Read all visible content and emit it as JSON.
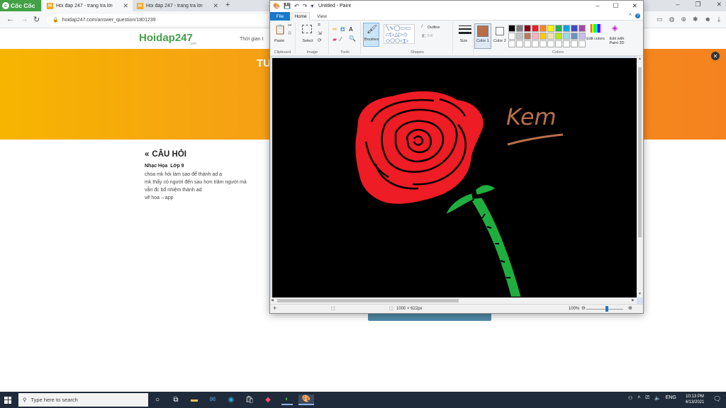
{
  "browser": {
    "brand": "Cốc Cốc",
    "tabs": [
      {
        "label": "Hỏi đáp 247 - trang tra lời"
      },
      {
        "label": "Hỏi đáp 247 - trang tra lời"
      }
    ],
    "url": "hoidap247.com/answer_question/1801239"
  },
  "site": {
    "logo": "Hoidap247",
    "logo_domain": ".com",
    "nav_text": "Thời gian t",
    "banner_title": "TU",
    "question": {
      "heading": "CÂU HỎI",
      "subject": "Nhạc Họa",
      "grade": "Lớp 9",
      "lines": [
        "choa mk hỏi làm sao để thành ad ạ",
        "mk thấy có người đến sau hơn trăm người mà",
        "vẫn đc bổ nhiệm thành ad",
        "vẽ hoa – app"
      ]
    }
  },
  "paint": {
    "title": "Untitled - Paint",
    "menus": {
      "file": "File",
      "home": "Home",
      "view": "View"
    },
    "groups": {
      "clipboard": "Clipboard",
      "image": "Image",
      "tools": "Tools",
      "shapes": "Shapes",
      "colors": "Colors"
    },
    "buttons": {
      "paste": "Paste",
      "select": "Select",
      "brushes": "Brushes",
      "outline": "Outline",
      "fill": "Fill",
      "size": "Size",
      "color1": "Color 1",
      "color2": "Color 2",
      "edit_colors": "Edit colors",
      "edit_with_paint3d": "Edit with Paint 3D"
    },
    "color1": "#b86f48",
    "color2": "#ffffff",
    "palette": [
      "#000000",
      "#7f7f7f",
      "#880015",
      "#ed1c24",
      "#ff7f27",
      "#fff200",
      "#22b14c",
      "#00a2e8",
      "#3f48cc",
      "#a349a4",
      "#ffffff",
      "#c3c3c3",
      "#b97a57",
      "#ffaec9",
      "#ffc90e",
      "#efe4b0",
      "#b5e61d",
      "#99d9ea",
      "#7092be",
      "#c8bfe7",
      "#ffffff",
      "#ffffff",
      "#ffffff",
      "#ffffff",
      "#ffffff",
      "#ffffff",
      "#ffffff",
      "#ffffff",
      "#ffffff",
      "#ffffff"
    ],
    "drawing": {
      "signature": "Kem"
    },
    "status": {
      "dimensions": "1000 × 622px",
      "zoom": "100%"
    }
  },
  "taskbar": {
    "search_placeholder": "Type here to search",
    "language": "ENG",
    "time": "10:13 PM",
    "date": "4/13/2021"
  }
}
